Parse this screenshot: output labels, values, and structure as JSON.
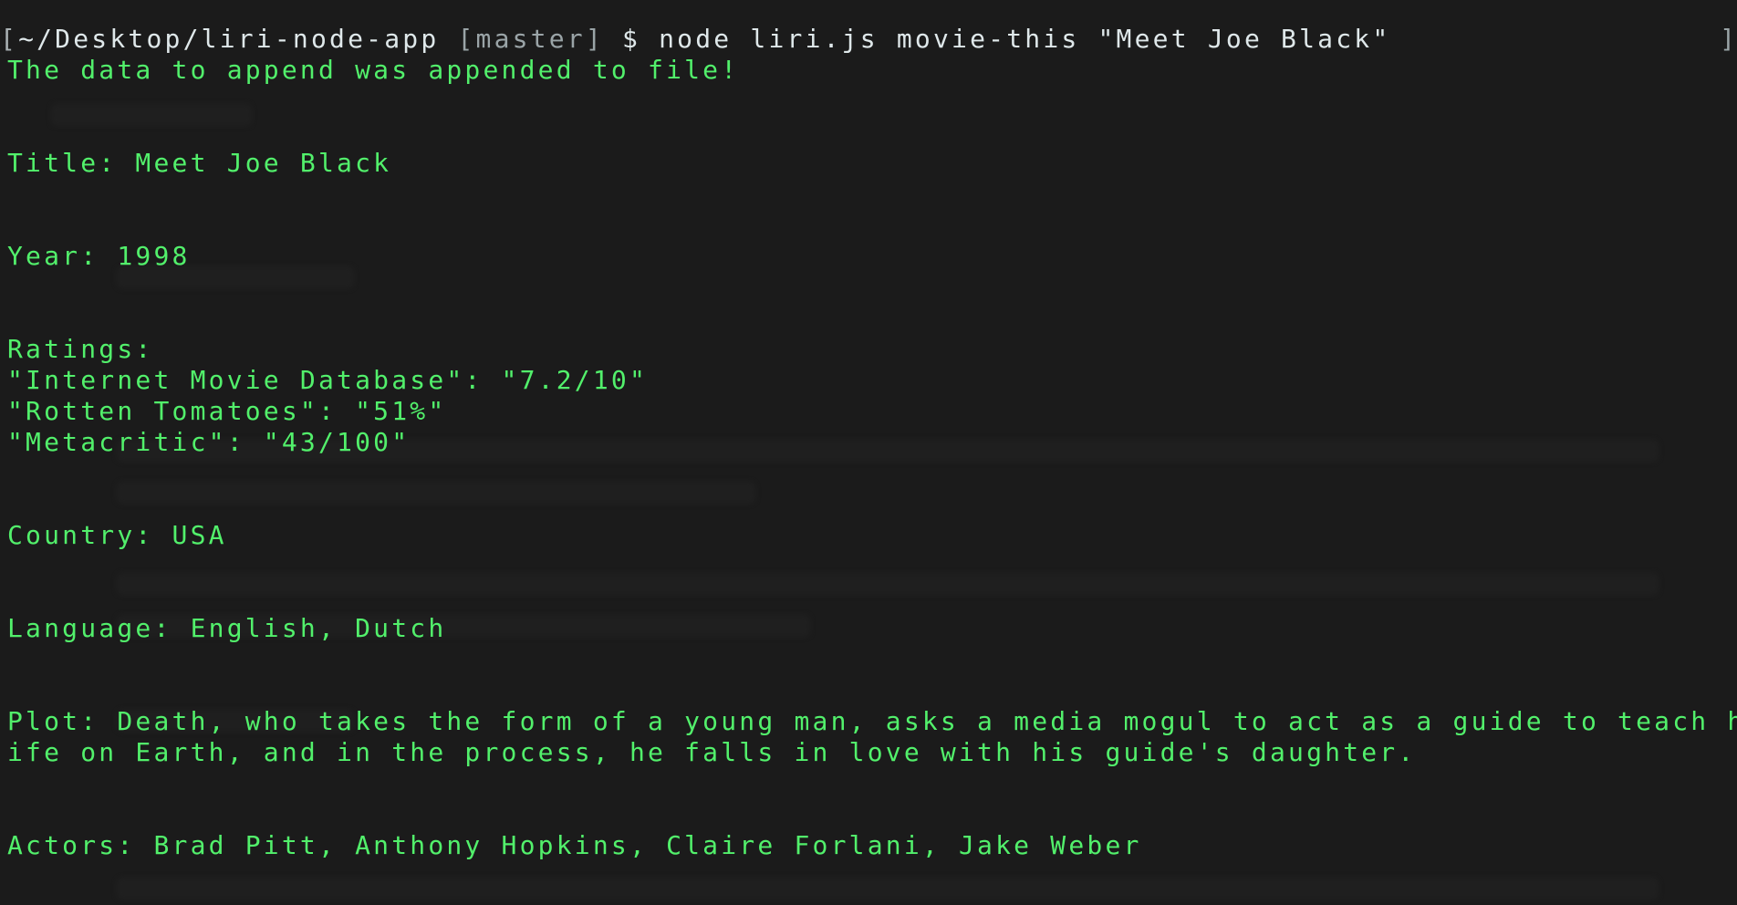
{
  "prompt": {
    "path": "~/Desktop/liri-node-app",
    "branch": "[master]",
    "symbol": "$",
    "command": "node liri.js movie-this \"Meet Joe Black\""
  },
  "output": {
    "append_message": "The data to append was appended to file!",
    "title": "Title: Meet Joe Black",
    "year": "Year: 1998",
    "ratings_label": "Ratings:",
    "ratings": [
      "\"Internet Movie Database\": \"7.2/10\"",
      "\"Rotten Tomatoes\": \"51%\"",
      "\"Metacritic\": \"43/100\""
    ],
    "country": "Country: USA",
    "language": "Language: English, Dutch",
    "plot_line1": "Plot: Death, who takes the form of a young man, asks a media mogul to act as a guide to teach him about l",
    "plot_line2": "ife on Earth, and in the process, he falls in love with his guide's daughter.",
    "actors": "Actors: Brad Pitt, Anthony Hopkins, Claire Forlani, Jake Weber"
  },
  "colors": {
    "background": "#1b1b1b",
    "output_text": "#52f06b",
    "prompt_text": "#dfe8ea",
    "branch_text": "#9aa4a7"
  }
}
